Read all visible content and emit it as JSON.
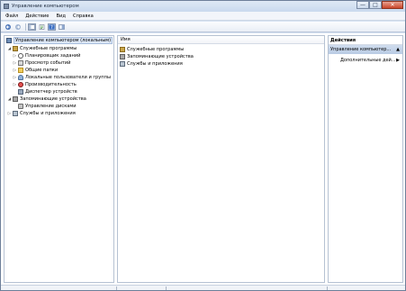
{
  "window": {
    "title": "Управление компьютером",
    "controls": [
      "—",
      "□",
      "✕"
    ]
  },
  "menu": [
    "Файл",
    "Действие",
    "Вид",
    "Справка"
  ],
  "toolbar": {
    "buttons": [
      "back-arrow-icon",
      "forward-arrow-icon",
      "show-hide-tree-icon",
      "properties-icon",
      "help-icon",
      "console-icon"
    ]
  },
  "tree": {
    "root": "Управление компьютером (локальным)",
    "items": [
      "Служебные программы",
      "Планировщик заданий",
      "Просмотр событий",
      "Общие папки",
      "Локальные пользователи и группы",
      "Производительность",
      "Диспетчер устройств",
      "Запоминающие устройства",
      "Управление дисками",
      "Службы и приложения"
    ],
    "expand_collapsed": "▷",
    "expand_open": "◢"
  },
  "center": {
    "column_header": "Имя",
    "rows": [
      "Служебные программы",
      "Запоминающие устройства",
      "Службы и приложения"
    ]
  },
  "actions": {
    "header": "Действия",
    "section": "Управление компьютер...",
    "section_arrow": "▲",
    "item": "Дополнительные дей...",
    "item_arrow": "▶"
  }
}
